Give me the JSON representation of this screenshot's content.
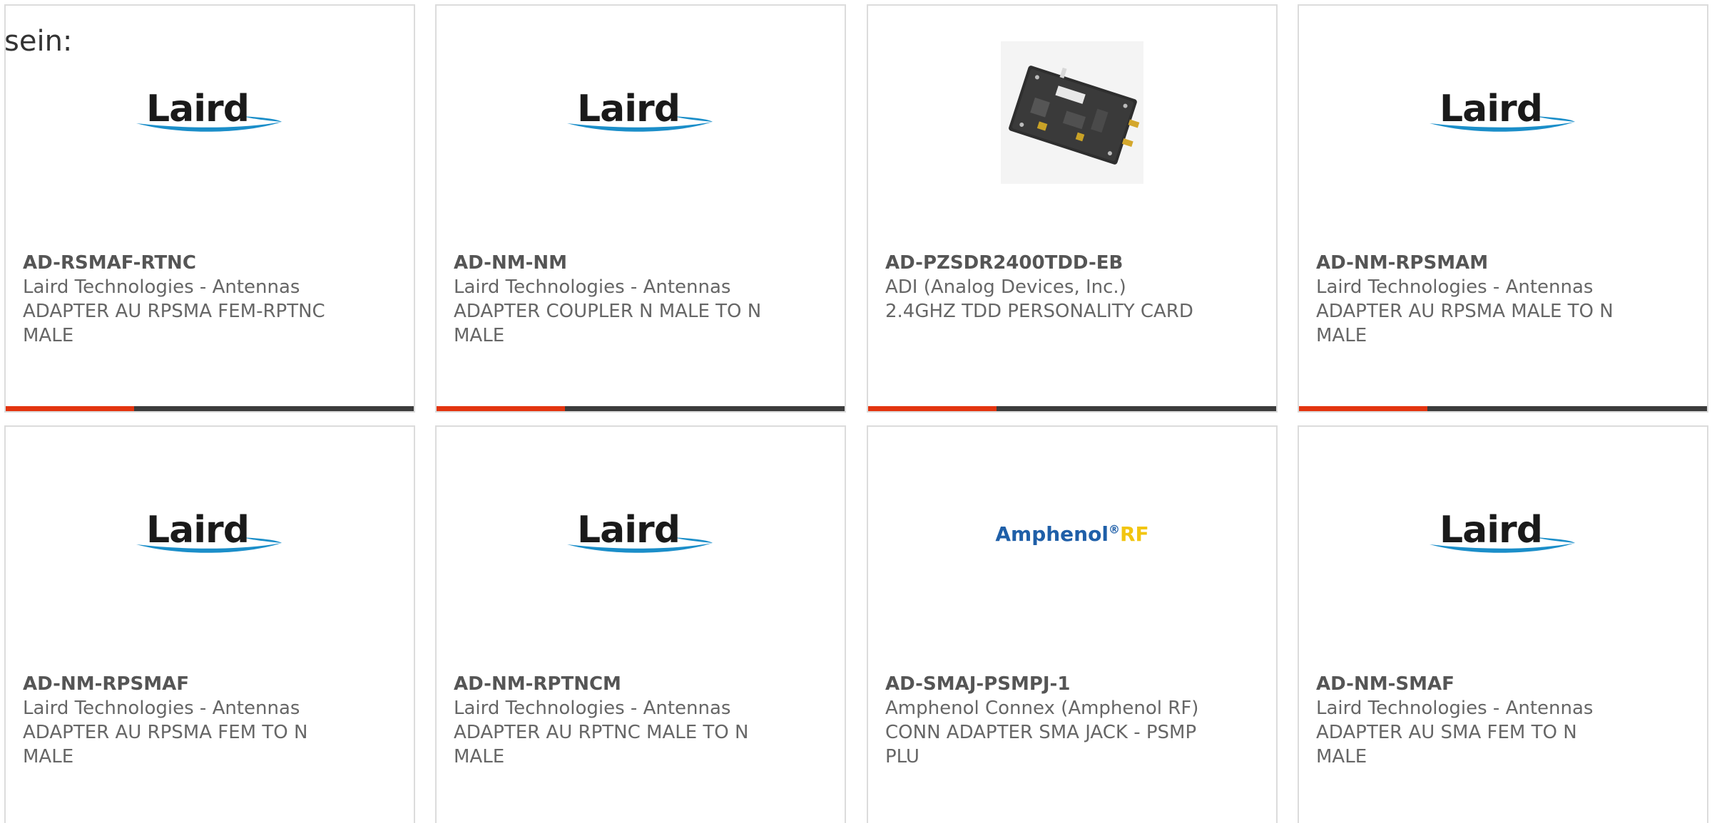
{
  "intro_text": "sein:",
  "colors": {
    "accent": "#e3340f",
    "bar_dark": "#3c3c3c",
    "laird_blue": "#1b8ec9",
    "amphenol_blue": "#1f5fa8",
    "amphenol_yellow": "#f2c510"
  },
  "logos": {
    "laird": "Laird",
    "amphenol": "Amphenol",
    "amphenol_reg": "®",
    "amphenol_rf": "RF"
  },
  "products": [
    {
      "part_number": "AD-RSMAF-RTNC",
      "manufacturer": "Laird Technologies - Antennas",
      "description": "ADAPTER AU RPSMA FEM-RPTNC MALE",
      "image": "laird-logo",
      "has_bar": true
    },
    {
      "part_number": "AD-NM-NM",
      "manufacturer": "Laird Technologies - Antennas",
      "description": "ADAPTER COUPLER N MALE TO N MALE",
      "image": "laird-logo",
      "has_bar": true
    },
    {
      "part_number": "AD-PZSDR2400TDD-EB",
      "manufacturer": "ADI (Analog Devices, Inc.)",
      "description": "2.4GHZ TDD PERSONALITY CARD",
      "image": "circuit-board-photo",
      "has_bar": true
    },
    {
      "part_number": "AD-NM-RPSMAM",
      "manufacturer": "Laird Technologies - Antennas",
      "description": "ADAPTER AU RPSMA MALE TO N MALE",
      "image": "laird-logo",
      "has_bar": true
    },
    {
      "part_number": "AD-NM-RPSMAF",
      "manufacturer": "Laird Technologies - Antennas",
      "description": "ADAPTER AU RPSMA FEM TO N MALE",
      "image": "laird-logo",
      "has_bar": false
    },
    {
      "part_number": "AD-NM-RPTNCM",
      "manufacturer": "Laird Technologies - Antennas",
      "description": "ADAPTER AU RPTNC MALE TO N MALE",
      "image": "laird-logo",
      "has_bar": false
    },
    {
      "part_number": "AD-SMAJ-PSMPJ-1",
      "manufacturer": "Amphenol Connex (Amphenol RF)",
      "description": "CONN ADAPTER SMA JACK - PSMP PLU",
      "image": "amphenol-rf-logo",
      "has_bar": false
    },
    {
      "part_number": "AD-NM-SMAF",
      "manufacturer": "Laird Technologies - Antennas",
      "description": "ADAPTER AU SMA FEM TO N MALE",
      "image": "laird-logo",
      "has_bar": false
    }
  ]
}
